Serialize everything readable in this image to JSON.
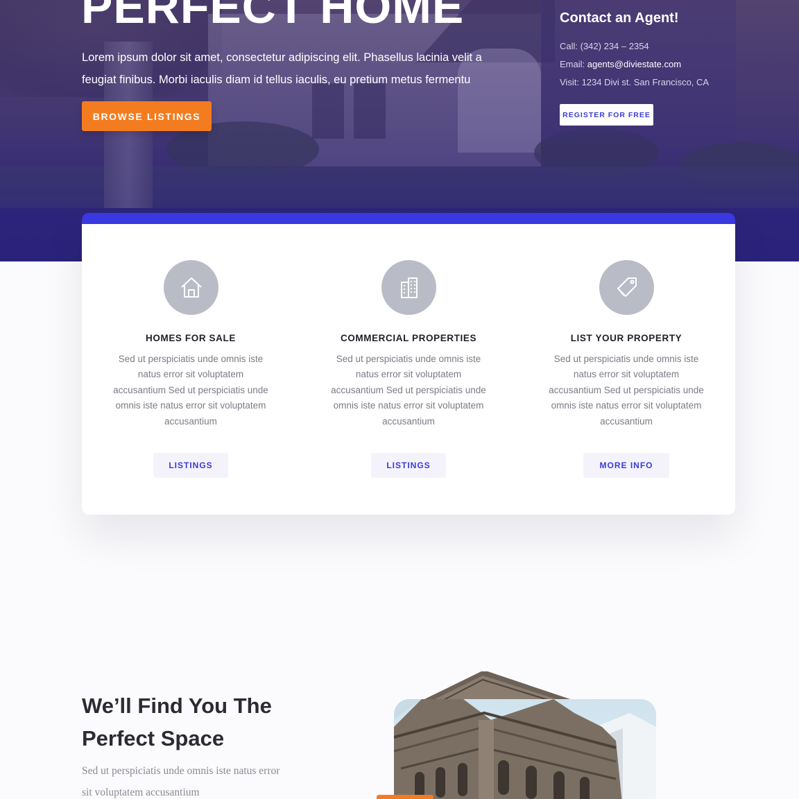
{
  "hero": {
    "title": "PERFECT HOME",
    "description": "Lorem ipsum dolor sit amet, consectetur adipiscing elit. Phasellus lacinia velit a feugiat finibus. Morbi iaculis diam id tellus iaculis, eu pretium metus fermentu",
    "browse_label": "BROWSE LISTINGS"
  },
  "contact": {
    "title": "Contact an Agent!",
    "call_label": "Call: ",
    "call_value": "(342) 234 – 2354",
    "email_label": "Email: ",
    "email_value": "agents@diviestate.com",
    "visit_label": "Visit: ",
    "visit_value": "1234 Divi st. San Francisco, CA",
    "register_label": "REGISTER FOR FREE"
  },
  "services": [
    {
      "icon": "home-icon",
      "title": "HOMES FOR SALE",
      "text": "Sed ut perspiciatis unde omnis iste natus error sit voluptatem accusantium Sed ut perspiciatis unde omnis iste natus error sit voluptatem accusantium",
      "button": "LISTINGS"
    },
    {
      "icon": "building-icon",
      "title": "COMMERCIAL PROPERTIES",
      "text": "Sed ut perspiciatis unde omnis iste natus error sit voluptatem accusantium Sed ut perspiciatis unde omnis iste natus error sit voluptatem accusantium",
      "button": "LISTINGS"
    },
    {
      "icon": "tag-icon",
      "title": "LIST YOUR PROPERTY",
      "text": "Sed ut perspiciatis unde omnis iste natus error sit voluptatem accusantium Sed ut perspiciatis unde omnis iste natus error sit voluptatem accusantium",
      "button": "MORE INFO"
    }
  ],
  "section": {
    "title": "We’ll Find You The Perfect Space",
    "text": "Sed ut perspiciatis unde omnis iste natus error sit voluptatem accusantium"
  },
  "colors": {
    "accent_orange": "#f47c20",
    "accent_blue": "#3a38e0",
    "hero_purple": "#382d72",
    "icon_gray": "#b9bcc6"
  }
}
